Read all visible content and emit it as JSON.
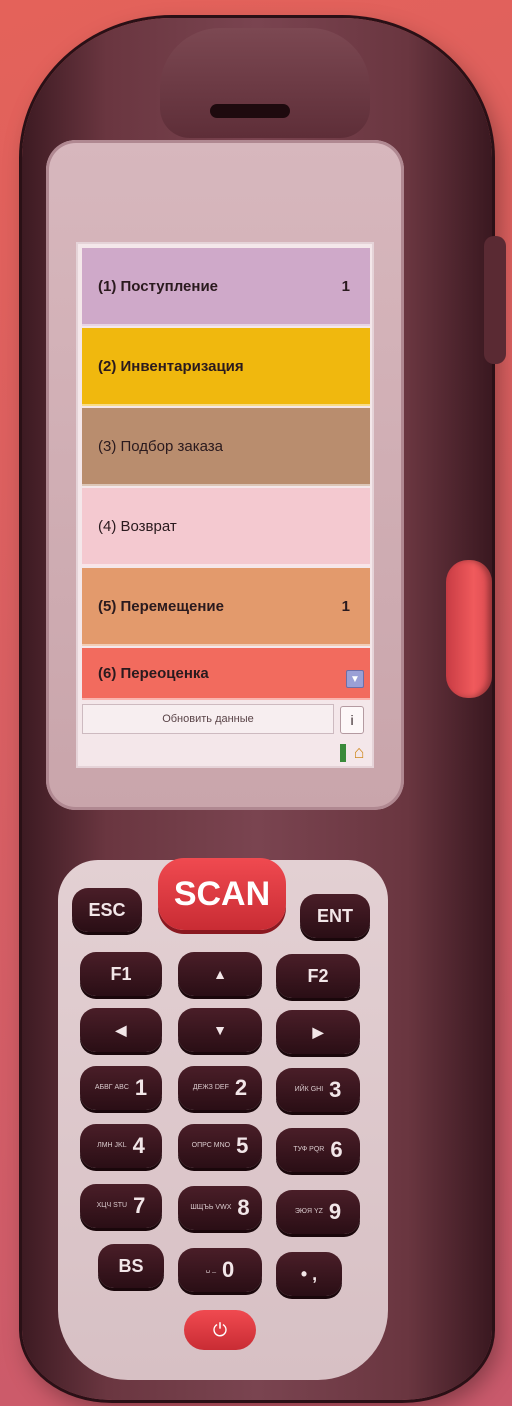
{
  "menu": {
    "items": [
      {
        "label": "(1) Поступление",
        "count": "1",
        "color": "#cfa9c9"
      },
      {
        "label": "(2) Инвентаризация",
        "count": "",
        "color": "#f0b80e"
      },
      {
        "label": "(3) Подбор заказа",
        "count": "",
        "color": "#b98d6e"
      },
      {
        "label": "(4) Возврат",
        "count": "",
        "color": "#f4c9d0"
      },
      {
        "label": "(5) Перемещение",
        "count": "1",
        "color": "#e39a6c"
      },
      {
        "label": "(6) Переоценка",
        "count": "",
        "color": "#f26b5e"
      }
    ],
    "refresh_label": "Обновить данные",
    "info_label": "i",
    "scroll_icon": "chevron-down-icon",
    "home_icon": "home-icon"
  },
  "keypad": {
    "esc": "ESC",
    "scan": "SCAN",
    "ent": "ENT",
    "f1": "F1",
    "f2": "F2",
    "up": "▲",
    "down": "▼",
    "left": "◀",
    "right": "▶",
    "k1": {
      "main": "1",
      "sub": "АБВГ ABC"
    },
    "k2": {
      "main": "2",
      "sub": "ДЕЖЗ DEF"
    },
    "k3": {
      "main": "3",
      "sub": "ИЙК GHI"
    },
    "k4": {
      "main": "4",
      "sub": "ЛМН JKL"
    },
    "k5": {
      "main": "5",
      "sub": "ОПРС MNO"
    },
    "k6": {
      "main": "6",
      "sub": "ТУФ PQR"
    },
    "k7": {
      "main": "7",
      "sub": "ХЦЧ STU"
    },
    "k8": {
      "main": "8",
      "sub": "ШЩЪЬ VWX"
    },
    "k9": {
      "main": "9",
      "sub": "ЭЮЯ YZ"
    },
    "bs": "BS",
    "k0": {
      "main": "0",
      "sub": "␣ _"
    },
    "punct": "• ,",
    "power": "⏻"
  }
}
